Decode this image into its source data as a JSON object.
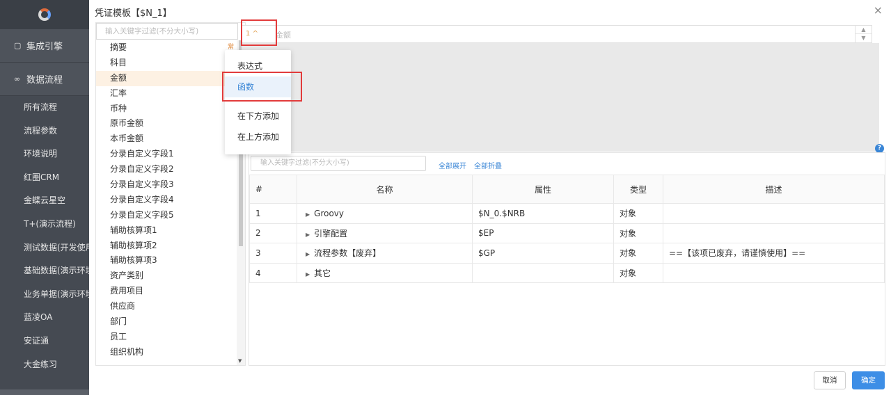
{
  "background_sidebar": {
    "sections": [
      {
        "icon": "▢",
        "label": "集成引擎"
      },
      {
        "icon": "∞",
        "label": "数据流程"
      }
    ],
    "items": [
      "所有流程",
      "流程参数",
      "环境说明",
      "红圈CRM",
      "金蝶云星空",
      "T+(演示流程)",
      "测试数据(开发使用",
      "基础数据(演示环境",
      "业务单据(演示环境",
      "蓝凌OA",
      "安证通",
      "大金练习"
    ]
  },
  "dialog": {
    "title": "凭证模板【$N_1】",
    "close": "×",
    "left_search_placeholder": "输入关键字过滤(不分大小写)",
    "fields": [
      {
        "label": "摘要",
        "mark": "常"
      },
      {
        "label": "科目",
        "mark": ""
      },
      {
        "label": "金额",
        "mark": ""
      },
      {
        "label": "汇率",
        "mark": ""
      },
      {
        "label": "币种",
        "mark": ""
      },
      {
        "label": "原币金额",
        "mark": ""
      },
      {
        "label": "本币金额",
        "mark": ""
      },
      {
        "label": "分录自定义字段1",
        "mark": ""
      },
      {
        "label": "分录自定义字段2",
        "mark": ""
      },
      {
        "label": "分录自定义字段3",
        "mark": ""
      },
      {
        "label": "分录自定义字段4",
        "mark": ""
      },
      {
        "label": "分录自定义字段5",
        "mark": ""
      },
      {
        "label": "辅助核算项1",
        "mark": ""
      },
      {
        "label": "辅助核算项2",
        "mark": ""
      },
      {
        "label": "辅助核算项3",
        "mark": ""
      },
      {
        "label": "资产类别",
        "mark": ""
      },
      {
        "label": "费用项目",
        "mark": ""
      },
      {
        "label": "供应商",
        "mark": ""
      },
      {
        "label": "部门",
        "mark": ""
      },
      {
        "label": "员工",
        "mark": ""
      },
      {
        "label": "组织机构",
        "mark": ""
      }
    ],
    "selected_field_index": 2,
    "context_menu": {
      "items": [
        "表达式",
        "函数",
        "在下方添加",
        "在上方添加"
      ],
      "active_index": 1
    },
    "editor": {
      "chip": "1 ^",
      "label": "金额",
      "spin_up": "▲",
      "spin_down": "▼"
    },
    "help": "?",
    "variables": {
      "search_placeholder": "输入关键字过滤(不分大小写)",
      "expand_all": "全部展开",
      "collapse_all": "全部折叠",
      "columns": [
        "#",
        "名称",
        "属性",
        "类型",
        "描述"
      ],
      "rows": [
        {
          "num": "1",
          "name": "Groovy",
          "prop": "$N_0.$NRB",
          "type": "对象",
          "desc": ""
        },
        {
          "num": "2",
          "name": "引擎配置",
          "prop": "$EP",
          "type": "对象",
          "desc": ""
        },
        {
          "num": "3",
          "name": "流程参数【废弃】",
          "prop": "$GP",
          "type": "对象",
          "desc": "==【该项已废弃，请谨慎使用】=="
        },
        {
          "num": "4",
          "name": "其它",
          "prop": "",
          "type": "对象",
          "desc": ""
        }
      ]
    },
    "buttons": {
      "cancel": "取消",
      "ok": "确定"
    }
  },
  "colors": {
    "accent": "#3d8ee6",
    "highlight": "#e23b3b",
    "selected_row": "#fdf1e3",
    "sidebar": "#454a52"
  }
}
